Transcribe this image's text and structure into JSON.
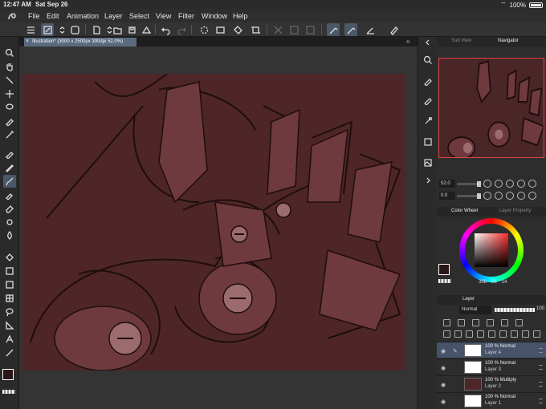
{
  "status": {
    "time": "12:47 AM",
    "date": "Sat Sep 26",
    "battery": "100%"
  },
  "menu": [
    "File",
    "Edit",
    "Animation",
    "Layer",
    "Select",
    "View",
    "Filter",
    "Window",
    "Help"
  ],
  "document": {
    "tab_title": "Illustration* (3000 x 2500px 300dpi 52.0%)"
  },
  "panels": {
    "nav_tabs": {
      "sub_view": "Sub View",
      "navigator": "Navigator"
    },
    "zoom": "52.0",
    "rotation": "0.0",
    "color_tabs": {
      "wheel": "Color Wheel",
      "layer_property": "Layer Property"
    },
    "color_values": {
      "h": "356",
      "s": "86",
      "v": "14"
    },
    "layer_title": "Layer",
    "blend_mode": "Normal",
    "opacity": "100"
  },
  "layers": [
    {
      "line1": "100 % Normal",
      "line2": "Layer 4",
      "selected": true
    },
    {
      "line1": "100 % Normal",
      "line2": "Layer 3",
      "selected": false
    },
    {
      "line1": "100 % Multiply",
      "line2": "Layer 2",
      "selected": false
    },
    {
      "line1": "100 % Normal",
      "line2": "Layer 1",
      "selected": false
    }
  ],
  "colors": {
    "accent": "#4a5868",
    "canvas_bg": "#4e2628",
    "nav_border": "#e04545",
    "current_color": "#2a1518"
  }
}
